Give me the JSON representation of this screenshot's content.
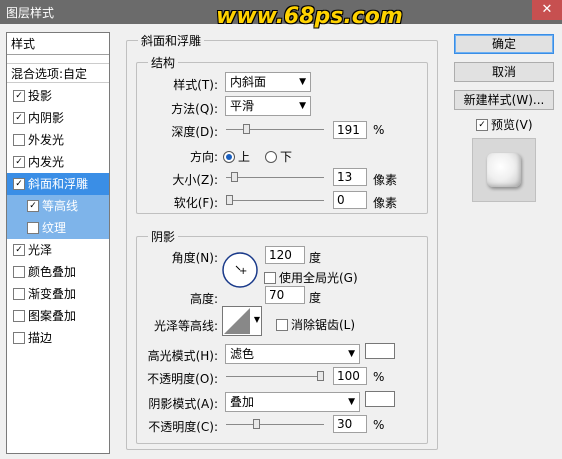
{
  "window": {
    "title": "图层样式",
    "watermark": "www.68ps.com",
    "close_glyph": "✕"
  },
  "sidebar": {
    "header": "样式",
    "blend_options": "混合选项:自定",
    "items": [
      {
        "label": "投影",
        "checked": true
      },
      {
        "label": "内阴影",
        "checked": true
      },
      {
        "label": "外发光",
        "checked": false
      },
      {
        "label": "内发光",
        "checked": true
      },
      {
        "label": "斜面和浮雕",
        "checked": true,
        "selected": true
      },
      {
        "label": "等高线",
        "checked": true,
        "sub": true
      },
      {
        "label": "纹理",
        "checked": false,
        "sub": true
      },
      {
        "label": "光泽",
        "checked": true
      },
      {
        "label": "颜色叠加",
        "checked": false
      },
      {
        "label": "渐变叠加",
        "checked": false
      },
      {
        "label": "图案叠加",
        "checked": false
      },
      {
        "label": "描边",
        "checked": false
      }
    ]
  },
  "bevel": {
    "group_title": "斜面和浮雕",
    "structure_title": "结构",
    "style_label": "样式(T):",
    "style_value": "内斜面",
    "technique_label": "方法(Q):",
    "technique_value": "平滑",
    "depth_label": "深度(D):",
    "depth_value": "191",
    "depth_unit": "%",
    "depth_level": 0.19,
    "direction_label": "方向:",
    "direction_up": "上",
    "direction_down": "下",
    "size_label": "大小(Z):",
    "size_value": "13",
    "size_unit": "像素",
    "size_level": 0.05,
    "soften_label": "软化(F):",
    "soften_value": "0",
    "soften_unit": "像素",
    "soften_level": 0.0
  },
  "shading": {
    "title": "阴影",
    "angle_label": "角度(N):",
    "angle_value": "120",
    "angle_unit": "度",
    "global_light_label": "使用全局光(G)",
    "altitude_label": "高度:",
    "altitude_value": "70",
    "altitude_unit": "度",
    "gloss_contour_label": "光泽等高线:",
    "antialias_label": "消除锯齿(L)",
    "highlight_mode_label": "高光模式(H):",
    "highlight_mode_value": "滤色",
    "highlight_color": "#ffffff",
    "highlight_opacity_label": "不透明度(O):",
    "highlight_opacity_value": "100",
    "highlight_opacity_unit": "%",
    "highlight_opacity_level": 1.0,
    "shadow_mode_label": "阴影模式(A):",
    "shadow_mode_value": "叠加",
    "shadow_color": "#ffffff",
    "shadow_opacity_label": "不透明度(C):",
    "shadow_opacity_value": "30",
    "shadow_opacity_unit": "%",
    "shadow_opacity_level": 0.3
  },
  "buttons": {
    "ok": "确定",
    "cancel": "取消",
    "new_style": "新建样式(W)...",
    "preview": "预览(V)"
  },
  "colors": {
    "accent": "#3a8ee6",
    "sub_selected": "#7eb4ea",
    "title_bar": "#6b6b6b"
  }
}
